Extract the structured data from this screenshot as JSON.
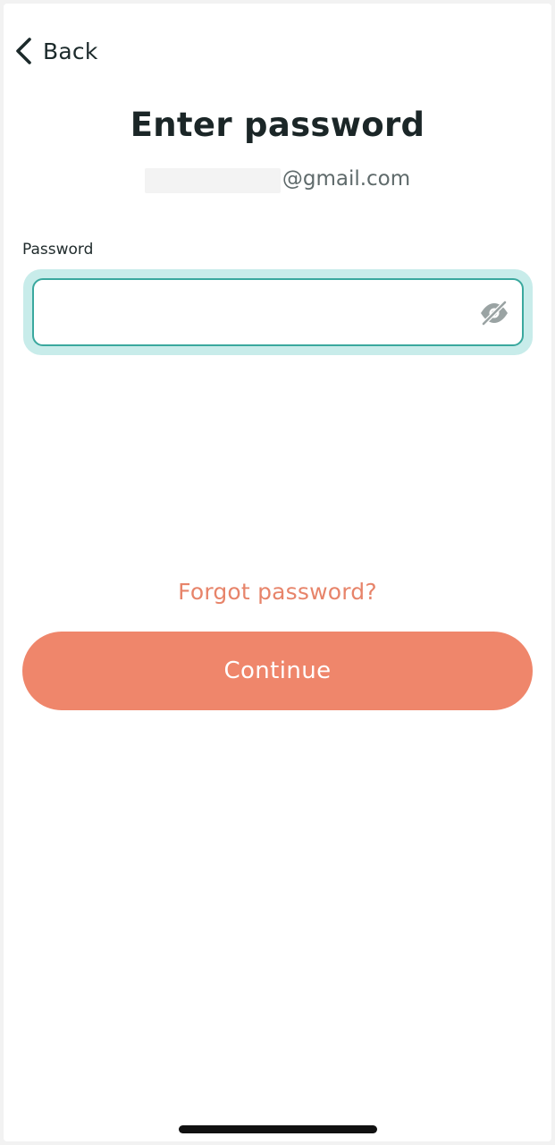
{
  "nav": {
    "back_label": "Back",
    "back_icon": "chevron-left-icon"
  },
  "header": {
    "title": "Enter password",
    "email_domain": "@gmail.com"
  },
  "password": {
    "label": "Password",
    "value": "",
    "placeholder": "",
    "visibility_icon": "eye-off-icon"
  },
  "actions": {
    "forgot_label": "Forgot password?",
    "continue_label": "Continue"
  },
  "colors": {
    "accent": "#ef866b",
    "link": "#e7846a",
    "focus_border": "#3aa89e",
    "focus_halo": "#c8ecea",
    "text": "#1b2627"
  }
}
